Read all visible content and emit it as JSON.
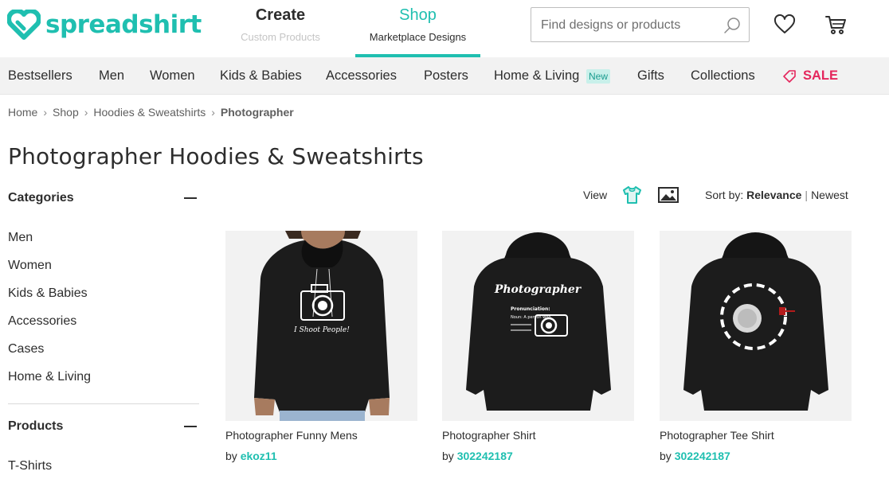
{
  "brand": {
    "name": "spreadshirt",
    "color": "#1fbfb0"
  },
  "top_nav": {
    "create": {
      "label": "Create",
      "sub": "Custom Products"
    },
    "shop": {
      "label": "Shop",
      "sub": "Marketplace Designs"
    }
  },
  "search": {
    "placeholder": "Find designs or products"
  },
  "categories_bar": {
    "items": [
      "Bestsellers",
      "Men",
      "Women",
      "Kids & Babies",
      "Accessories",
      "Posters",
      "Home & Living",
      "Gifts",
      "Collections"
    ],
    "new_badge": "New",
    "sale": "SALE"
  },
  "breadcrumb": [
    "Home",
    "Shop",
    "Hoodies & Sweatshirts",
    "Photographer"
  ],
  "page_title": "Photographer Hoodies & Sweatshirts",
  "sidebar": {
    "categories_title": "Categories",
    "categories": [
      "Men",
      "Women",
      "Kids & Babies",
      "Accessories",
      "Cases",
      "Home & Living"
    ],
    "products_title": "Products",
    "products": [
      "T-Shirts"
    ]
  },
  "toolbar": {
    "view_label": "View",
    "sort_label": "Sort by:",
    "sort_active": "Relevance",
    "sort_other": "Newest"
  },
  "products": [
    {
      "name": "Photographer Funny Mens",
      "by": "by",
      "designer": "ekoz11",
      "print_text": "I Shoot People!"
    },
    {
      "name": "Photographer Shirt",
      "by": "by",
      "designer": "302242187",
      "print_title": "Photographer",
      "print_sub": "Pronunciation:",
      "print_noun": "Noun: A person who"
    },
    {
      "name": "Photographer Tee Shirt",
      "by": "by",
      "designer": "302242187"
    }
  ],
  "colors": {
    "accent": "#1fbfb0",
    "sale": "#e4265c",
    "text": "#2d2d2d"
  }
}
